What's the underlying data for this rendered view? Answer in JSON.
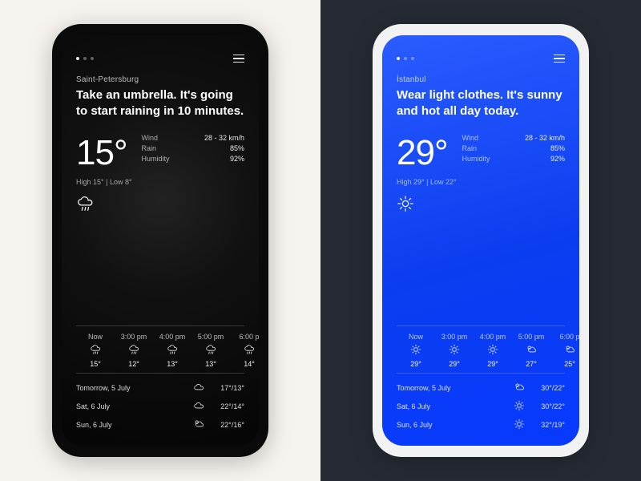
{
  "phones": [
    {
      "theme": "rain",
      "city": "Saint-Petersburg",
      "headline": "Take an umbrella.\nIt's going to start raining in 10 minutes.",
      "temp": "15°",
      "stats": {
        "wind_l": "Wind",
        "wind_v": "28 - 32 km/h",
        "rain_l": "Rain",
        "rain_v": "85%",
        "hum_l": "Humidity",
        "hum_v": "92%"
      },
      "hilo": "High 15° | Low 8°",
      "cond_icon": "rain",
      "hourly": [
        {
          "t": "Now",
          "icon": "rain",
          "v": "15°"
        },
        {
          "t": "3:00 pm",
          "icon": "rain",
          "v": "12°"
        },
        {
          "t": "4:00 pm",
          "icon": "rain",
          "v": "13°"
        },
        {
          "t": "5:00 pm",
          "icon": "rain",
          "v": "13°"
        },
        {
          "t": "6:00 p",
          "icon": "rain",
          "v": "14°"
        }
      ],
      "daily": [
        {
          "d": "Tomorrow, 5 July",
          "icon": "cloud",
          "v": "17°/13°"
        },
        {
          "d": "Sat, 6 July",
          "icon": "cloud",
          "v": "22°/14°"
        },
        {
          "d": "Sun, 6 July",
          "icon": "partsun",
          "v": "22°/16°"
        }
      ]
    },
    {
      "theme": "sun",
      "city": "İstanbul",
      "headline": "Wear light clothes.\nIt's sunny and hot all day today.",
      "temp": "29°",
      "stats": {
        "wind_l": "Wind",
        "wind_v": "28 - 32 km/h",
        "rain_l": "Rain",
        "rain_v": "85%",
        "hum_l": "Humidity",
        "hum_v": "92%"
      },
      "hilo": "High 29° | Low 22°",
      "cond_icon": "sun",
      "hourly": [
        {
          "t": "Now",
          "icon": "sun",
          "v": "29°"
        },
        {
          "t": "3:00 pm",
          "icon": "sun",
          "v": "29°"
        },
        {
          "t": "4:00 pm",
          "icon": "sun",
          "v": "29°"
        },
        {
          "t": "5:00 pm",
          "icon": "partsun",
          "v": "27°"
        },
        {
          "t": "6:00 p",
          "icon": "partsun",
          "v": "25°"
        }
      ],
      "daily": [
        {
          "d": "Tomorrow, 5 July",
          "icon": "partsun",
          "v": "30°/22°"
        },
        {
          "d": "Sat, 6 July",
          "icon": "sun",
          "v": "30°/22°"
        },
        {
          "d": "Sun, 6 July",
          "icon": "sun",
          "v": "32°/19°"
        }
      ]
    }
  ]
}
